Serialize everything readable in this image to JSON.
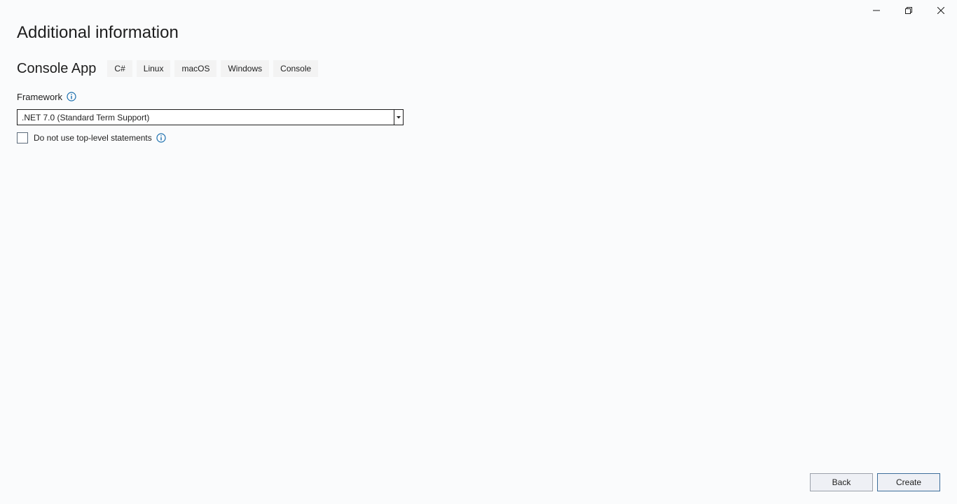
{
  "window": {
    "controls": {
      "minimize_icon": "minimize-icon",
      "restore_icon": "restore-icon",
      "close_icon": "close-icon"
    }
  },
  "header": {
    "title": "Additional information"
  },
  "template": {
    "name": "Console App",
    "tags": [
      "C#",
      "Linux",
      "macOS",
      "Windows",
      "Console"
    ]
  },
  "framework": {
    "label": "Framework",
    "info_icon": "info-icon",
    "selected": ".NET 7.0 (Standard Term Support)"
  },
  "options": {
    "top_level_statements": {
      "label": "Do not use top-level statements",
      "checked": false,
      "info_icon": "info-icon"
    }
  },
  "footer": {
    "back_label": "Back",
    "create_label": "Create"
  },
  "colors": {
    "background": "#FAFBFC",
    "text": "#1E1E1E",
    "tag_background": "#F3F3F3",
    "info_blue": "#1B6FAE",
    "button_background": "#EEF0F5",
    "primary_border": "#3D6E9B"
  }
}
